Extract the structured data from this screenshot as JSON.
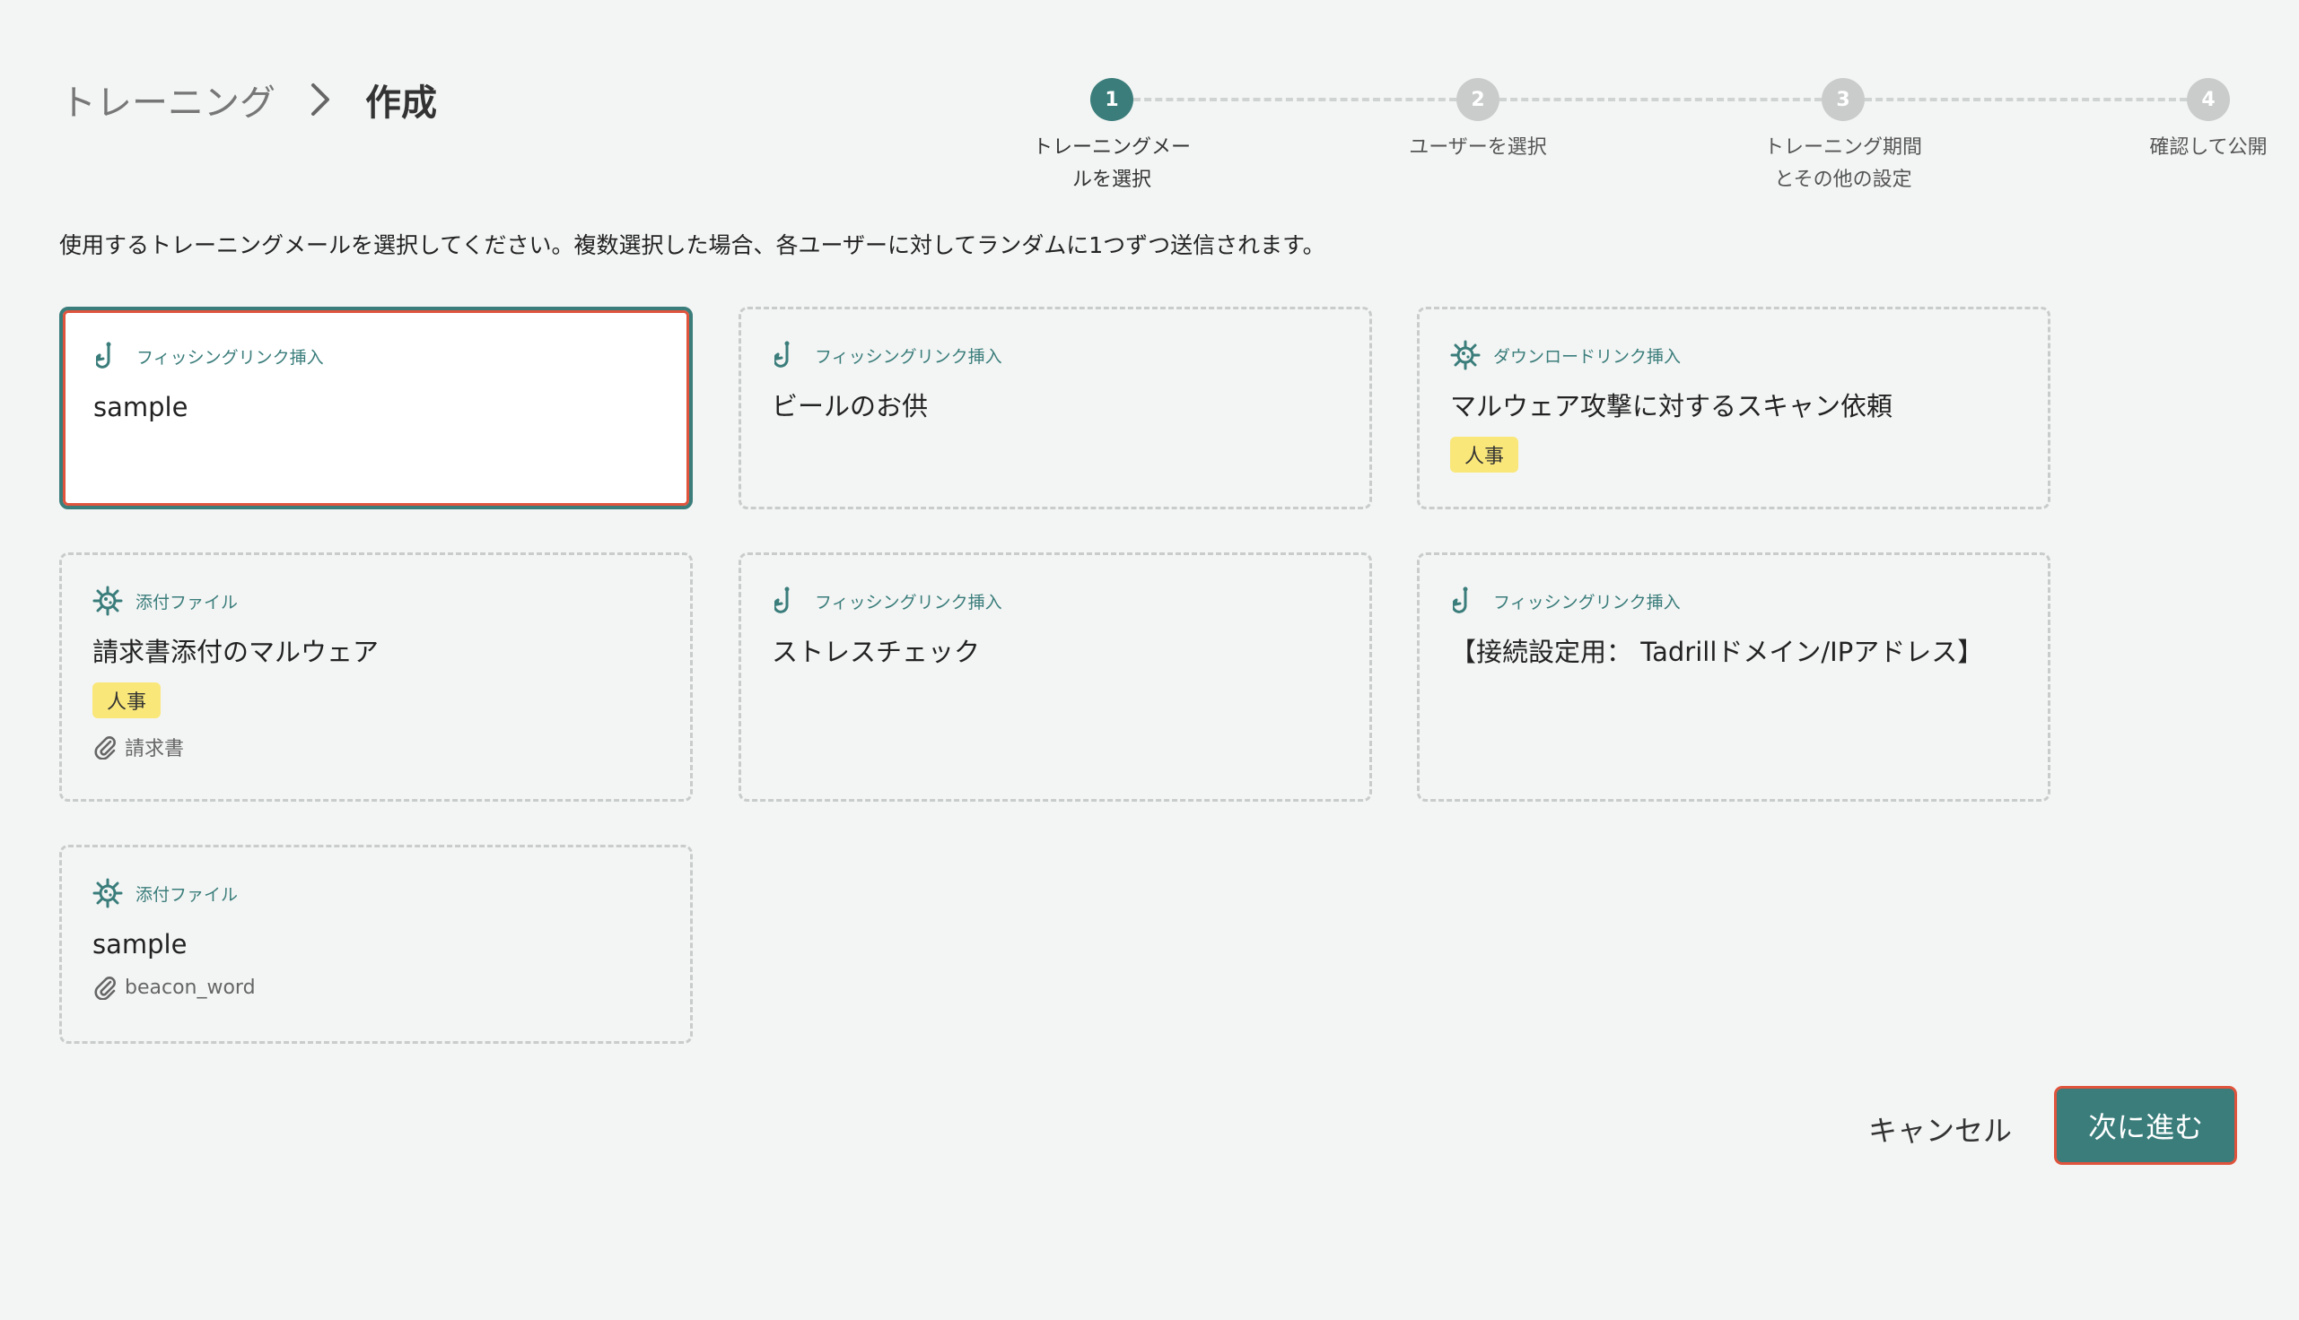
{
  "breadcrumb": {
    "root": "トレーニング",
    "current": "作成"
  },
  "stepper": {
    "steps": [
      {
        "number": "1",
        "label_line1": "トレーニングメー",
        "label_line2": "ルを選択",
        "active": true
      },
      {
        "number": "2",
        "label_line1": "ユーザーを選択",
        "label_line2": "",
        "active": false
      },
      {
        "number": "3",
        "label_line1": "トレーニング期間",
        "label_line2": "とその他の設定",
        "active": false
      },
      {
        "number": "4",
        "label_line1": "確認して公開",
        "label_line2": "",
        "active": false
      }
    ]
  },
  "instruction": "使用するトレーニングメールを選択してください。複数選択した場合、各ユーザーに対してランダムに1つずつ送信されます。",
  "cards": [
    {
      "type": "フィッシングリンク挿入",
      "icon": "hook-icon",
      "title": "sample",
      "tag": "",
      "attachment": "",
      "selected": true
    },
    {
      "type": "フィッシングリンク挿入",
      "icon": "hook-icon",
      "title": "ビールのお供",
      "tag": "",
      "attachment": "",
      "selected": false
    },
    {
      "type": "ダウンロードリンク挿入",
      "icon": "virus-icon",
      "title": "マルウェア攻撃に対するスキャン依頼",
      "tag": "人事",
      "attachment": "",
      "selected": false
    },
    {
      "type": "添付ファイル",
      "icon": "virus-icon",
      "title": "請求書添付のマルウェア",
      "tag": "人事",
      "attachment": "請求書",
      "selected": false
    },
    {
      "type": "フィッシングリンク挿入",
      "icon": "hook-icon",
      "title": "ストレスチェック",
      "tag": "",
      "attachment": "",
      "selected": false
    },
    {
      "type": "フィッシングリンク挿入",
      "icon": "hook-icon",
      "title": "【接続設定用： Tadrillドメイン/IPアドレス】",
      "tag": "",
      "attachment": "",
      "selected": false
    },
    {
      "type": "添付ファイル",
      "icon": "virus-icon",
      "title": "sample",
      "tag": "",
      "attachment": "beacon_word",
      "selected": false
    }
  ],
  "actions": {
    "cancel_label": "キャンセル",
    "next_label": "次に進む"
  },
  "colors": {
    "accent": "#3a7d7b",
    "tag_bg": "#f9e77a",
    "highlight": "#e0533c"
  }
}
